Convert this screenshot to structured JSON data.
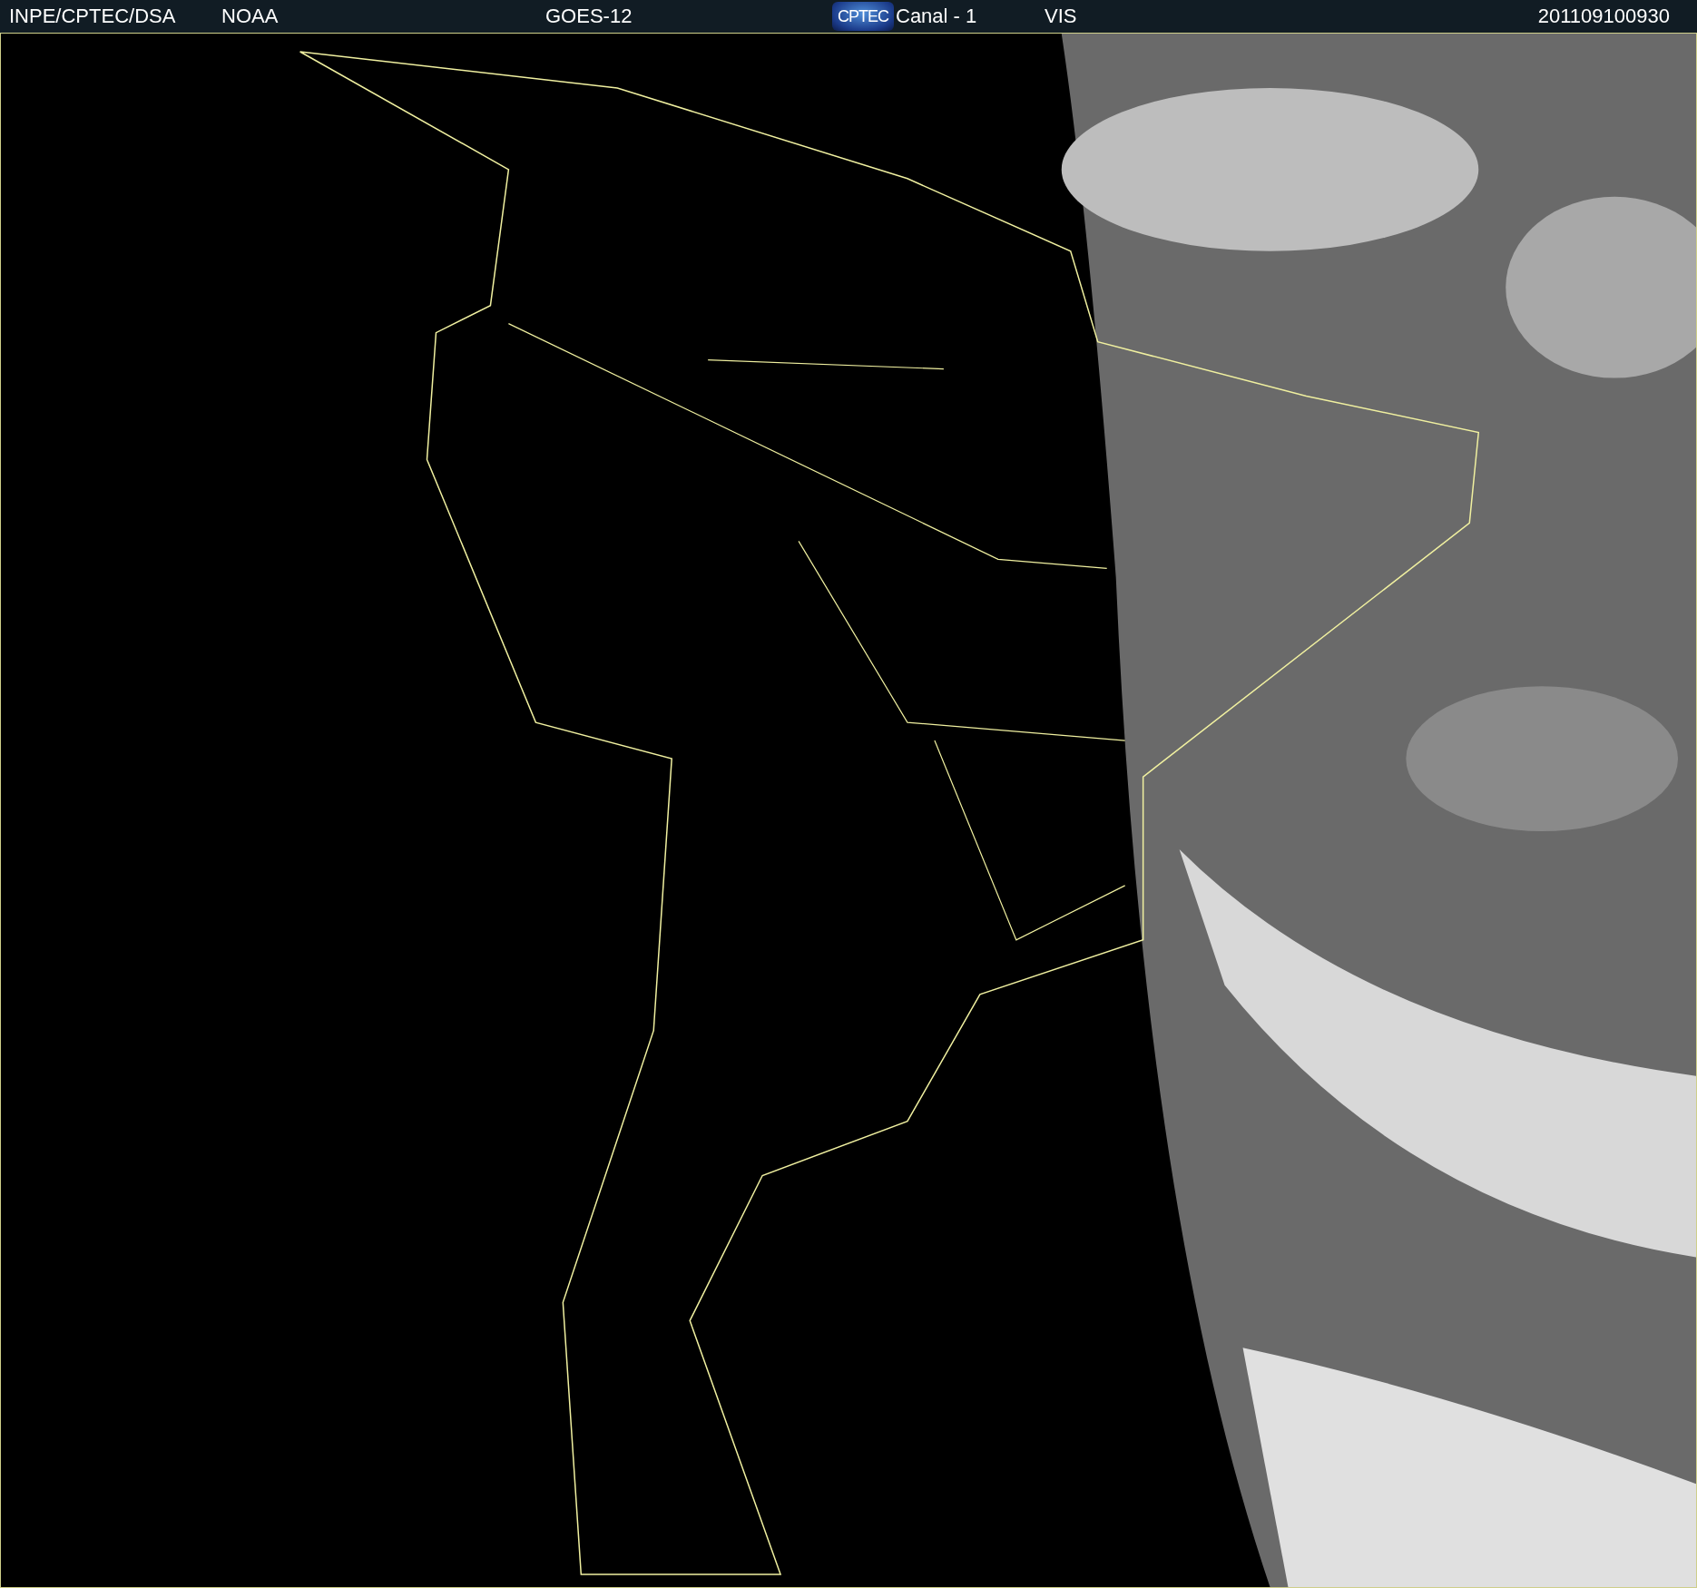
{
  "header": {
    "source": "INPE/CPTEC/DSA",
    "agency": "NOAA",
    "satellite": "GOES-12",
    "logo": "CPTEC",
    "channel": "Canal - 1",
    "band": "VIS",
    "timestamp": "201109100930"
  }
}
